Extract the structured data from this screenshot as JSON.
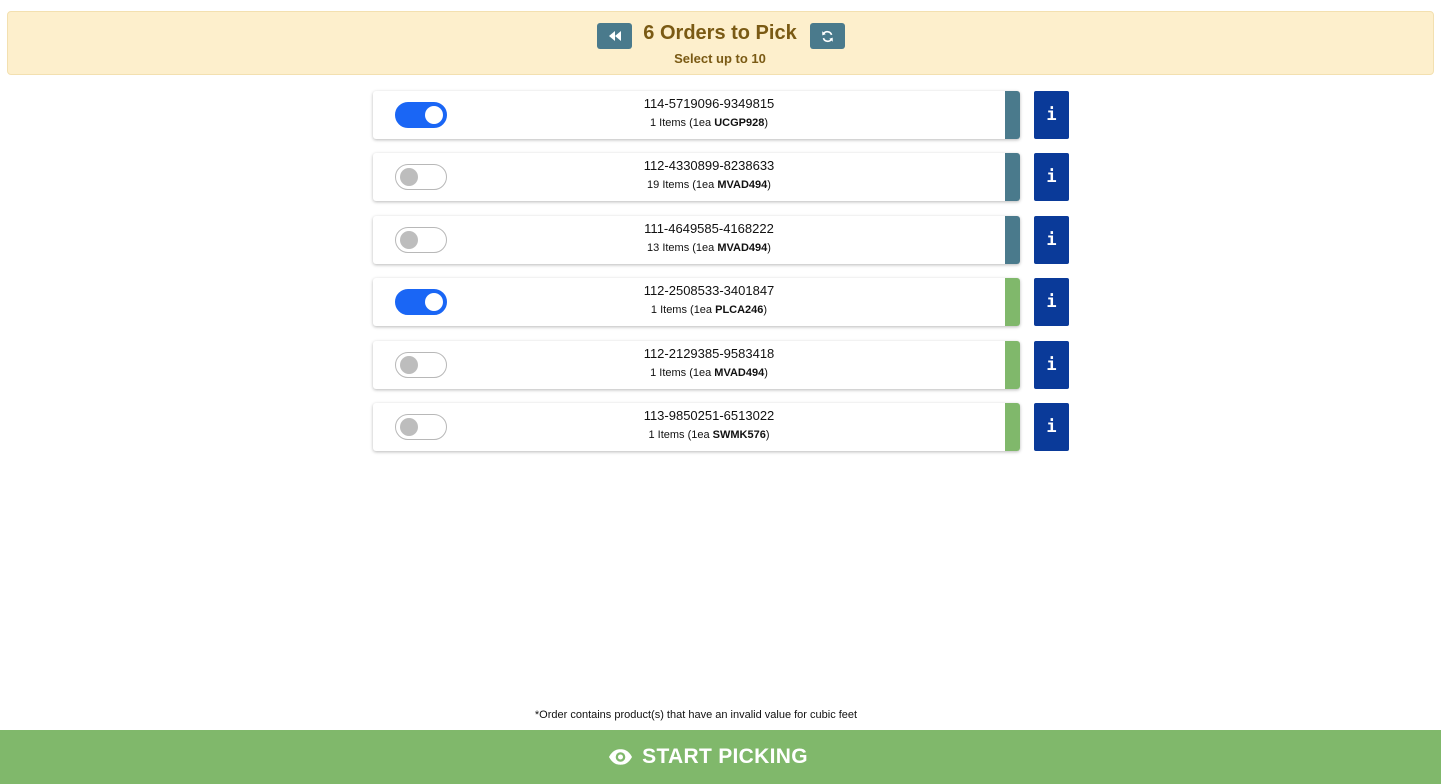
{
  "header": {
    "title": "6 Orders to Pick",
    "subtitle": "Select up to 10",
    "back_icon": "rewind-icon",
    "refresh_icon": "refresh-icon",
    "background_color": "#fdefcc",
    "button_color": "#4a7a8c"
  },
  "orders": [
    {
      "id": "114-5719096-9349815",
      "items_prefix": "1 Items (1ea ",
      "sku": "UCGP928",
      "items_suffix": ")",
      "selected": true,
      "status_color": "#4a7a8c"
    },
    {
      "id": "112-4330899-8238633",
      "items_prefix": "19 Items (1ea ",
      "sku": "MVAD494",
      "items_suffix": ")",
      "selected": false,
      "status_color": "#4a7a8c"
    },
    {
      "id": "111-4649585-4168222",
      "items_prefix": "13 Items (1ea ",
      "sku": "MVAD494",
      "items_suffix": ")",
      "selected": false,
      "status_color": "#4a7a8c"
    },
    {
      "id": "112-2508533-3401847",
      "items_prefix": "1 Items (1ea ",
      "sku": "PLCA246",
      "items_suffix": ")",
      "selected": true,
      "status_color": "#80b86b"
    },
    {
      "id": "112-2129385-9583418",
      "items_prefix": "1 Items (1ea ",
      "sku": "MVAD494",
      "items_suffix": ")",
      "selected": false,
      "status_color": "#80b86b"
    },
    {
      "id": "113-9850251-6513022",
      "items_prefix": "1 Items (1ea ",
      "sku": "SWMK576",
      "items_suffix": ")",
      "selected": false,
      "status_color": "#80b86b"
    }
  ],
  "info_button_label": "i",
  "footnote": "*Order contains product(s) that have an invalid value for cubic feet",
  "start_button": {
    "label": "START PICKING",
    "icon": "eye-icon",
    "color": "#80b86b"
  }
}
